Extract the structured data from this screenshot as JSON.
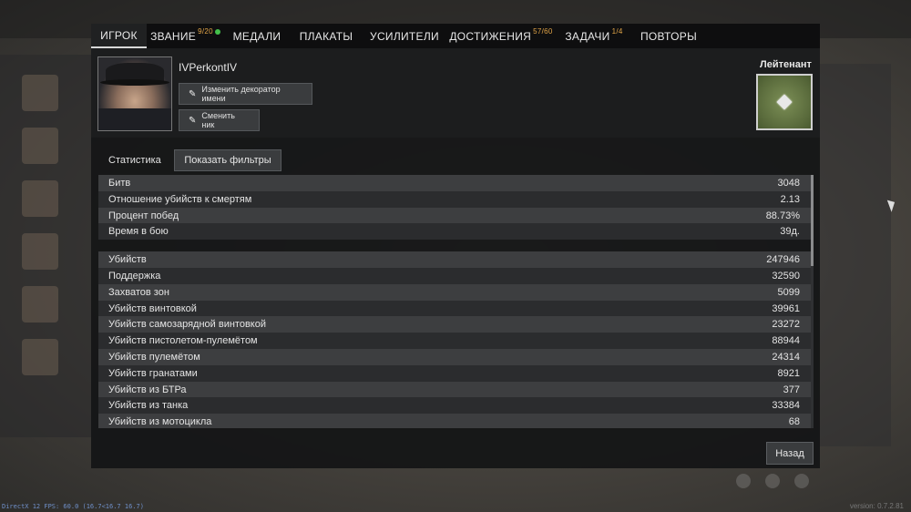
{
  "tabs": [
    {
      "label": "ИГРОК",
      "badge": ""
    },
    {
      "label": "ЗВАНИЕ",
      "badge": "9/20"
    },
    {
      "label": "МЕДАЛИ",
      "badge": ""
    },
    {
      "label": "ПЛАКАТЫ",
      "badge": ""
    },
    {
      "label": "УСИЛИТЕЛИ",
      "badge": ""
    },
    {
      "label": "ДОСТИЖЕНИЯ",
      "badge": "57/60"
    },
    {
      "label": "ЗАДАЧИ",
      "badge": "1/4"
    },
    {
      "label": "ПОВТОРЫ",
      "badge": ""
    }
  ],
  "profile": {
    "nickname": "IVPerkontIV",
    "change_decorator_label": "Изменить декоратор имени",
    "change_nick_label": "Сменить ник",
    "rank_title": "Лейтенант",
    "pencil_icon": "pencil-icon",
    "rank_badge_color": "#5a6b3c"
  },
  "stats": {
    "label": "Статистика",
    "filter_button": "Показать фильтры",
    "group1": [
      {
        "name": "Битв",
        "value": "3048"
      },
      {
        "name": "Отношение убийств к смертям",
        "value": "2.13"
      },
      {
        "name": "Процент побед",
        "value": "88.73%"
      },
      {
        "name": "Время в бою",
        "value": "39д."
      }
    ],
    "group2": [
      {
        "name": "Убийств",
        "value": "247946"
      },
      {
        "name": "Поддержка",
        "value": "32590"
      },
      {
        "name": "Захватов зон",
        "value": "5099"
      },
      {
        "name": "Убийств винтовкой",
        "value": "39961"
      },
      {
        "name": "Убийств самозарядной винтовкой",
        "value": "23272"
      },
      {
        "name": "Убийств пистолетом-пулемётом",
        "value": "88944"
      },
      {
        "name": "Убийств пулемётом",
        "value": "24314"
      },
      {
        "name": "Убийств гранатами",
        "value": "8921"
      },
      {
        "name": "Убийств из БТРа",
        "value": "377"
      },
      {
        "name": "Убийств из танка",
        "value": "33384"
      },
      {
        "name": "Убийств из мотоцикла",
        "value": "68"
      }
    ]
  },
  "footer": {
    "back_button": "Назад",
    "fps_text": "DirectX 12 FPS: 60.0 (16.7<16.7 16.7)",
    "version_text": "version: 0.7.2.81"
  },
  "colors": {
    "accent_badge": "#e2a548",
    "notification_dot": "#44c04b"
  }
}
